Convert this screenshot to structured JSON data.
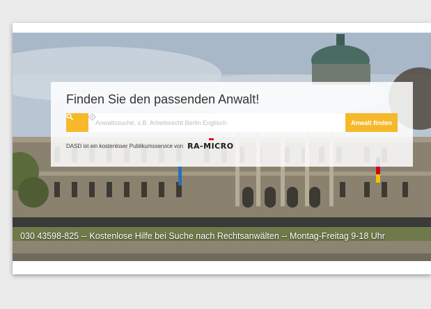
{
  "hero": {
    "headline": "Finden Sie den passenden Anwalt!",
    "search": {
      "placeholder": "Anwaltssuche, z.B. Arbeitsrecht Berlin Englisch",
      "submit_label": "Anwalt finden"
    },
    "service_text": "DASD ist ein kostenloser Publikumsservice von",
    "logo_text": "RA-MICRO",
    "hotline": "030 43598-825 -- Kostenlose Hilfe bei Suche nach Rechtsanwälten -- Montag-Freitag 9-18 Uhr"
  },
  "colors": {
    "accent": "#f6b92b",
    "page_background": "#ebebeb",
    "logo_accent": "#e2001a"
  },
  "icons": [
    "search-icon",
    "locate-icon"
  ]
}
